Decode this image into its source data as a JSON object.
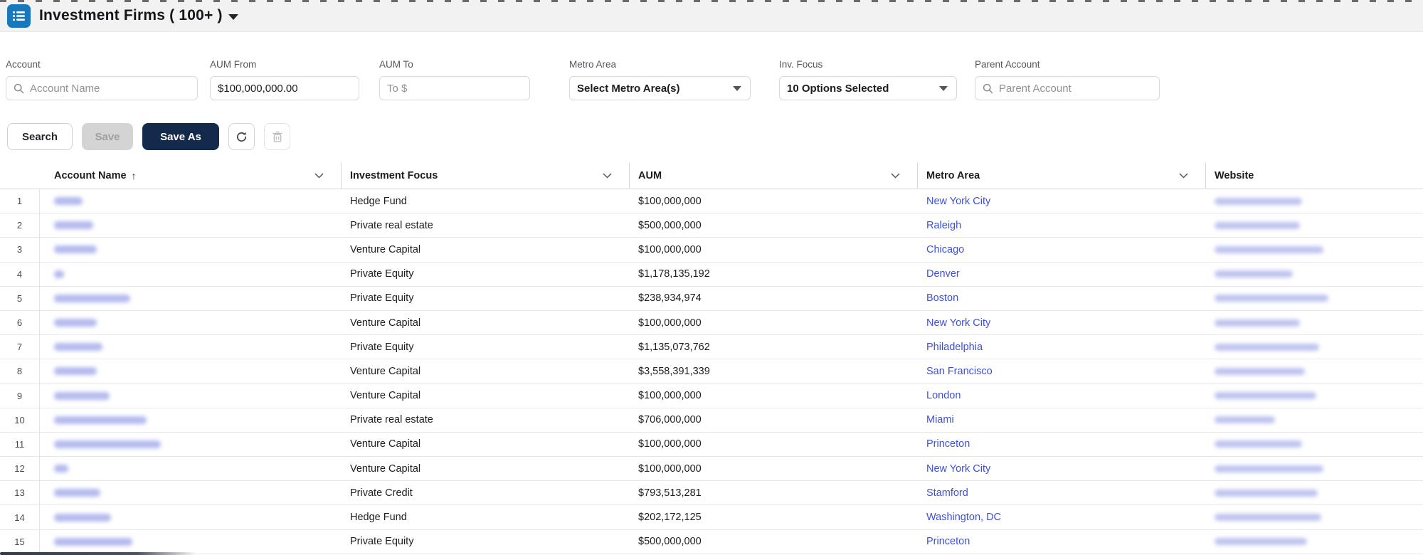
{
  "page": {
    "title": "Investment Firms ( 100+ )"
  },
  "filters": {
    "account": {
      "label": "Account",
      "placeholder": "Account Name"
    },
    "aum_from": {
      "label": "AUM From",
      "value": "$100,000,000.00"
    },
    "aum_to": {
      "label": "AUM To",
      "placeholder": "To $"
    },
    "metro_area": {
      "label": "Metro Area",
      "value": "Select Metro Area(s)"
    },
    "inv_focus": {
      "label": "Inv. Focus",
      "value": "10 Options Selected"
    },
    "parent_account": {
      "label": "Parent Account",
      "placeholder": "Parent Account"
    }
  },
  "toolbar": {
    "search_label": "Search",
    "save_label": "Save",
    "save_as_label": "Save As"
  },
  "table": {
    "columns": [
      {
        "label": "Account Name",
        "sorted": "asc",
        "sort_arrow": "↑"
      },
      {
        "label": "Investment Focus"
      },
      {
        "label": "AUM"
      },
      {
        "label": "Metro Area"
      },
      {
        "label": "Website"
      }
    ],
    "rows": [
      {
        "num": 1,
        "account_redacted_width": 40,
        "investment_focus": "Hedge Fund",
        "aum": "$100,000,000",
        "metro_area": "New York City",
        "website_redacted_width": 123
      },
      {
        "num": 2,
        "account_redacted_width": 55,
        "investment_focus": "Private real estate",
        "aum": "$500,000,000",
        "metro_area": "Raleigh",
        "website_redacted_width": 120
      },
      {
        "num": 3,
        "account_redacted_width": 60,
        "investment_focus": "Venture Capital",
        "aum": "$100,000,000",
        "metro_area": "Chicago",
        "website_redacted_width": 153
      },
      {
        "num": 4,
        "account_redacted_width": 14,
        "investment_focus": "Private Equity",
        "aum": "$1,178,135,192",
        "metro_area": "Denver",
        "website_redacted_width": 110
      },
      {
        "num": 5,
        "account_redacted_width": 107,
        "investment_focus": "Private Equity",
        "aum": "$238,934,974",
        "metro_area": "Boston",
        "website_redacted_width": 160
      },
      {
        "num": 6,
        "account_redacted_width": 60,
        "investment_focus": "Venture Capital",
        "aum": "$100,000,000",
        "metro_area": "New York City",
        "website_redacted_width": 120
      },
      {
        "num": 7,
        "account_redacted_width": 68,
        "investment_focus": "Private Equity",
        "aum": "$1,135,073,762",
        "metro_area": "Philadelphia",
        "website_redacted_width": 147
      },
      {
        "num": 8,
        "account_redacted_width": 60,
        "investment_focus": "Venture Capital",
        "aum": "$3,558,391,339",
        "metro_area": "San Francisco",
        "website_redacted_width": 127
      },
      {
        "num": 9,
        "account_redacted_width": 78,
        "investment_focus": "Venture Capital",
        "aum": "$100,000,000",
        "metro_area": "London",
        "website_redacted_width": 143
      },
      {
        "num": 10,
        "account_redacted_width": 130,
        "investment_focus": "Private real estate",
        "aum": "$706,000,000",
        "metro_area": "Miami",
        "website_redacted_width": 85
      },
      {
        "num": 11,
        "account_redacted_width": 150,
        "investment_focus": "Venture Capital",
        "aum": "$100,000,000",
        "metro_area": "Princeton",
        "website_redacted_width": 123
      },
      {
        "num": 12,
        "account_redacted_width": 20,
        "investment_focus": "Venture Capital",
        "aum": "$100,000,000",
        "metro_area": "New York City",
        "website_redacted_width": 153
      },
      {
        "num": 13,
        "account_redacted_width": 65,
        "investment_focus": "Private Credit",
        "aum": "$793,513,281",
        "metro_area": "Stamford",
        "website_redacted_width": 145
      },
      {
        "num": 14,
        "account_redacted_width": 80,
        "investment_focus": "Hedge Fund",
        "aum": "$202,172,125",
        "metro_area": "Washington, DC",
        "website_redacted_width": 150
      },
      {
        "num": 15,
        "account_redacted_width": 110,
        "investment_focus": "Private Equity",
        "aum": "$500,000,000",
        "metro_area": "Princeton",
        "website_redacted_width": 130
      }
    ]
  },
  "colors": {
    "accent_blue": "#1878be",
    "link_blue": "#3c50dc",
    "save_as_bg": "#142a4c",
    "header_band_bg": "#f3f2f2"
  }
}
